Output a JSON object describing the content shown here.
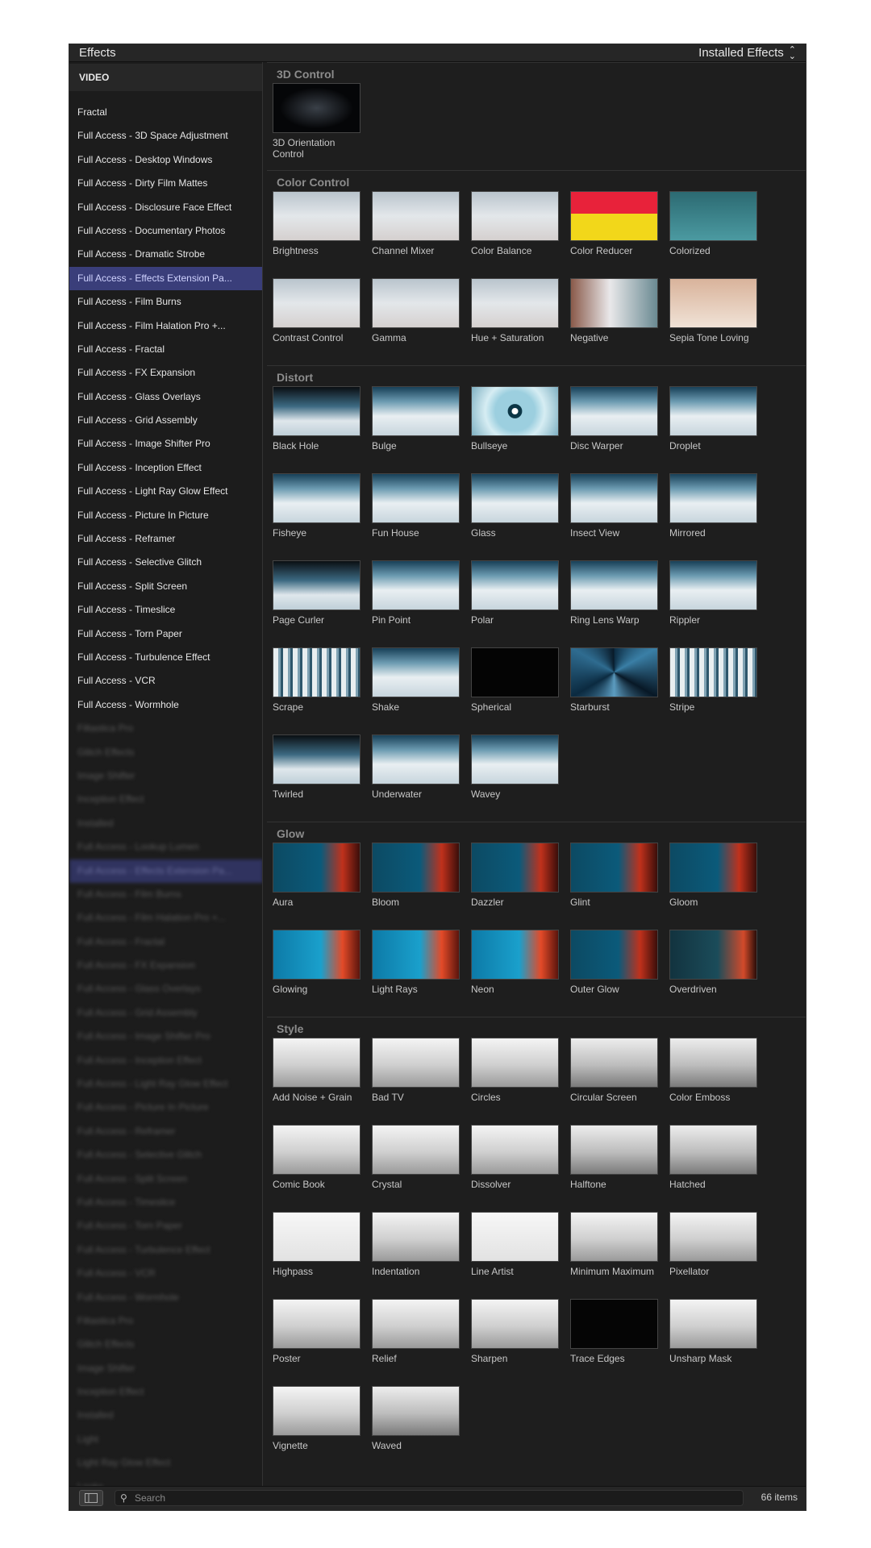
{
  "window": {
    "title": "Effects",
    "source_selector": "Installed Effects"
  },
  "sidebar": {
    "section": "VIDEO",
    "items": [
      {
        "label": "Fractal"
      },
      {
        "label": "Full Access - 3D Space Adjustment"
      },
      {
        "label": "Full Access - Desktop Windows"
      },
      {
        "label": "Full Access - Dirty Film Mattes"
      },
      {
        "label": "Full Access - Disclosure Face Effect"
      },
      {
        "label": "Full Access - Documentary Photos"
      },
      {
        "label": "Full Access - Dramatic Strobe"
      },
      {
        "label": "Full Access - Effects Extension Pa...",
        "selected": true
      },
      {
        "label": "Full Access - Film Burns"
      },
      {
        "label": "Full Access - Film Halation Pro +..."
      },
      {
        "label": "Full Access - Fractal"
      },
      {
        "label": "Full Access - FX Expansion"
      },
      {
        "label": "Full Access - Glass Overlays"
      },
      {
        "label": "Full Access - Grid Assembly"
      },
      {
        "label": "Full Access - Image Shifter Pro"
      },
      {
        "label": "Full Access - Inception Effect"
      },
      {
        "label": "Full Access - Light Ray Glow Effect"
      },
      {
        "label": "Full Access - Picture In Picture"
      },
      {
        "label": "Full Access - Reframer"
      },
      {
        "label": "Full Access - Selective Glitch"
      },
      {
        "label": "Full Access - Split Screen"
      },
      {
        "label": "Full Access - Timeslice"
      },
      {
        "label": "Full Access - Torn Paper"
      },
      {
        "label": "Full Access - Turbulence Effect"
      },
      {
        "label": "Full Access - VCR"
      },
      {
        "label": "Full Access - Wormhole"
      },
      {
        "label": "Filtastica Pro",
        "blurred": true
      },
      {
        "label": "Glitch Effects",
        "blurred": true
      },
      {
        "label": "Image Shifter",
        "blurred": true
      },
      {
        "label": "Inception Effect",
        "blurred": true
      },
      {
        "label": "Installed",
        "blurred": true
      },
      {
        "label": "Full Access - Lookup Lumen",
        "blurred": true
      },
      {
        "label": "Full Access - Effects Extension Pa...",
        "blurred": true,
        "selected": true
      },
      {
        "label": "Full Access - Film Burns",
        "blurred": true
      },
      {
        "label": "Full Access - Film Halation Pro +...",
        "blurred": true
      },
      {
        "label": "Full Access - Fractal",
        "blurred": true
      },
      {
        "label": "Full Access - FX Expansion",
        "blurred": true
      },
      {
        "label": "Full Access - Glass Overlays",
        "blurred": true
      },
      {
        "label": "Full Access - Grid Assembly",
        "blurred": true
      },
      {
        "label": "Full Access - Image Shifter Pro",
        "blurred": true
      },
      {
        "label": "Full Access - Inception Effect",
        "blurred": true
      },
      {
        "label": "Full Access - Light Ray Glow Effect",
        "blurred": true
      },
      {
        "label": "Full Access - Picture In Picture",
        "blurred": true
      },
      {
        "label": "Full Access - Reframer",
        "blurred": true
      },
      {
        "label": "Full Access - Selective Glitch",
        "blurred": true
      },
      {
        "label": "Full Access - Split Screen",
        "blurred": true
      },
      {
        "label": "Full Access - Timeslice",
        "blurred": true
      },
      {
        "label": "Full Access - Torn Paper",
        "blurred": true
      },
      {
        "label": "Full Access - Turbulence Effect",
        "blurred": true
      },
      {
        "label": "Full Access - VCR",
        "blurred": true
      },
      {
        "label": "Full Access - Wormhole",
        "blurred": true
      },
      {
        "label": "Filtastica Pro",
        "blurred": true
      },
      {
        "label": "Glitch Effects",
        "blurred": true
      },
      {
        "label": "Image Shifter",
        "blurred": true
      },
      {
        "label": "Inception Effect",
        "blurred": true
      },
      {
        "label": "Installed",
        "blurred": true
      },
      {
        "label": "Light",
        "blurred": true
      },
      {
        "label": "Light Ray Glow Effect",
        "blurred": true
      },
      {
        "label": "Looks",
        "blurred": true
      }
    ]
  },
  "categories": [
    {
      "name": "3D Control",
      "effects": [
        {
          "name": "3D Orientation Control",
          "style": "g-cam"
        }
      ]
    },
    {
      "name": "Color Control",
      "effects": [
        {
          "name": "Brightness",
          "style": "g-dancer"
        },
        {
          "name": "Channel Mixer",
          "style": "g-dancer"
        },
        {
          "name": "Color Balance",
          "style": "g-dancer"
        },
        {
          "name": "Color Reducer",
          "style": "g-yellow"
        },
        {
          "name": "Colorized",
          "style": "g-teal"
        },
        {
          "name": "Contrast Control",
          "style": "g-dancer"
        },
        {
          "name": "Gamma",
          "style": "g-dancer"
        },
        {
          "name": "Hue + Saturation",
          "style": "g-dancer"
        },
        {
          "name": "Negative",
          "style": "g-neg"
        },
        {
          "name": "Sepia Tone Loving",
          "style": "g-sepia"
        }
      ]
    },
    {
      "name": "Distort",
      "effects": [
        {
          "name": "Black Hole",
          "style": "g-snowdark"
        },
        {
          "name": "Bulge",
          "style": "g-snow"
        },
        {
          "name": "Bullseye",
          "style": "g-bulls"
        },
        {
          "name": "Disc Warper",
          "style": "g-snow"
        },
        {
          "name": "Droplet",
          "style": "g-snow"
        },
        {
          "name": "Fisheye",
          "style": "g-snow"
        },
        {
          "name": "Fun House",
          "style": "g-snow"
        },
        {
          "name": "Glass",
          "style": "g-snow"
        },
        {
          "name": "Insect View",
          "style": "g-snow"
        },
        {
          "name": "Mirrored",
          "style": "g-snow"
        },
        {
          "name": "Page Curler",
          "style": "g-snowdark"
        },
        {
          "name": "Pin Point",
          "style": "g-snow"
        },
        {
          "name": "Polar",
          "style": "g-snow"
        },
        {
          "name": "Ring Lens Warp",
          "style": "g-snow"
        },
        {
          "name": "Rippler",
          "style": "g-snow"
        },
        {
          "name": "Scrape",
          "style": "g-stripe"
        },
        {
          "name": "Shake",
          "style": "g-snow"
        },
        {
          "name": "Spherical",
          "style": "g-black"
        },
        {
          "name": "Starburst",
          "style": "g-star"
        },
        {
          "name": "Stripe",
          "style": "g-stripe"
        },
        {
          "name": "Twirled",
          "style": "g-snowdark"
        },
        {
          "name": "Underwater",
          "style": "g-snow"
        },
        {
          "name": "Wavey",
          "style": "g-snow"
        }
      ]
    },
    {
      "name": "Glow",
      "effects": [
        {
          "name": "Aura",
          "style": "g-glow"
        },
        {
          "name": "Bloom",
          "style": "g-glow"
        },
        {
          "name": "Dazzler",
          "style": "g-glow"
        },
        {
          "name": "Glint",
          "style": "g-glow"
        },
        {
          "name": "Gloom",
          "style": "g-glow"
        },
        {
          "name": "Glowing",
          "style": "g-glowb"
        },
        {
          "name": "Light Rays",
          "style": "g-glowb"
        },
        {
          "name": "Neon",
          "style": "g-glowb"
        },
        {
          "name": "Outer Glow",
          "style": "g-glow"
        },
        {
          "name": "Overdriven",
          "style": "g-glowd"
        }
      ]
    },
    {
      "name": "Style",
      "effects": [
        {
          "name": "Add Noise + Grain",
          "style": "g-car"
        },
        {
          "name": "Bad TV",
          "style": "g-car"
        },
        {
          "name": "Circles",
          "style": "g-car"
        },
        {
          "name": "Circular Screen",
          "style": "g-cargray"
        },
        {
          "name": "Color Emboss",
          "style": "g-cargray"
        },
        {
          "name": "Comic Book",
          "style": "g-car"
        },
        {
          "name": "Crystal",
          "style": "g-car"
        },
        {
          "name": "Dissolver",
          "style": "g-car"
        },
        {
          "name": "Halftone",
          "style": "g-cargray"
        },
        {
          "name": "Hatched",
          "style": "g-cargray"
        },
        {
          "name": "Highpass",
          "style": "g-carline"
        },
        {
          "name": "Indentation",
          "style": "g-car"
        },
        {
          "name": "Line Artist",
          "style": "g-carline"
        },
        {
          "name": "Minimum Maximum",
          "style": "g-car"
        },
        {
          "name": "Pixellator",
          "style": "g-car"
        },
        {
          "name": "Poster",
          "style": "g-car"
        },
        {
          "name": "Relief",
          "style": "g-car"
        },
        {
          "name": "Sharpen",
          "style": "g-car"
        },
        {
          "name": "Trace Edges",
          "style": "g-cardark"
        },
        {
          "name": "Unsharp Mask",
          "style": "g-car"
        },
        {
          "name": "Vignette",
          "style": "g-car"
        },
        {
          "name": "Waved",
          "style": "g-cargray"
        }
      ]
    }
  ],
  "footer": {
    "search_placeholder": "Search",
    "search_value": "",
    "item_count": "66 items"
  },
  "colors": {
    "window_bg": "#1e1e1e",
    "selection": "#3a3e7a",
    "category_text": "#8c8c8c"
  }
}
